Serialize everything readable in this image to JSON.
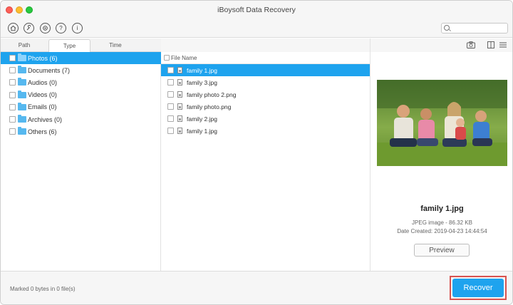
{
  "app": {
    "title": "iBoysoft Data Recovery"
  },
  "toolbar": {
    "icons": [
      "home-icon",
      "tools-icon",
      "settings-icon",
      "help-icon",
      "info-icon"
    ],
    "help_glyph": "?",
    "info_glyph": "i",
    "search_placeholder": ""
  },
  "left_tabs": [
    {
      "label": "Path"
    },
    {
      "label": "Type",
      "active": true
    },
    {
      "label": "Time"
    }
  ],
  "type_list": [
    {
      "label": "Photos (6)",
      "selected": true
    },
    {
      "label": "Documents (7)"
    },
    {
      "label": "Audios (0)"
    },
    {
      "label": "Videos (0)"
    },
    {
      "label": "Emails (0)"
    },
    {
      "label": "Archives (0)"
    },
    {
      "label": "Others (6)"
    }
  ],
  "file_list": {
    "header": "File Name",
    "rows": [
      {
        "name": "family 1.jpg",
        "selected": true
      },
      {
        "name": "family 3.jpg"
      },
      {
        "name": "family photo 2.png"
      },
      {
        "name": "family photo.png"
      },
      {
        "name": "family 2.jpg"
      },
      {
        "name": "family 1.jpg"
      }
    ]
  },
  "preview": {
    "file_name": "family 1.jpg",
    "type_size": "JPEG image - 86.32 KB",
    "date_created": "Date Created: 2019-04-23 14:44:54",
    "button_label": "Preview"
  },
  "footer": {
    "status": "Marked 0 bytes in 0 file(s)",
    "recover_label": "Recover"
  },
  "colors": {
    "accent": "#1ea3ee",
    "highlight_border": "#d9534f"
  }
}
